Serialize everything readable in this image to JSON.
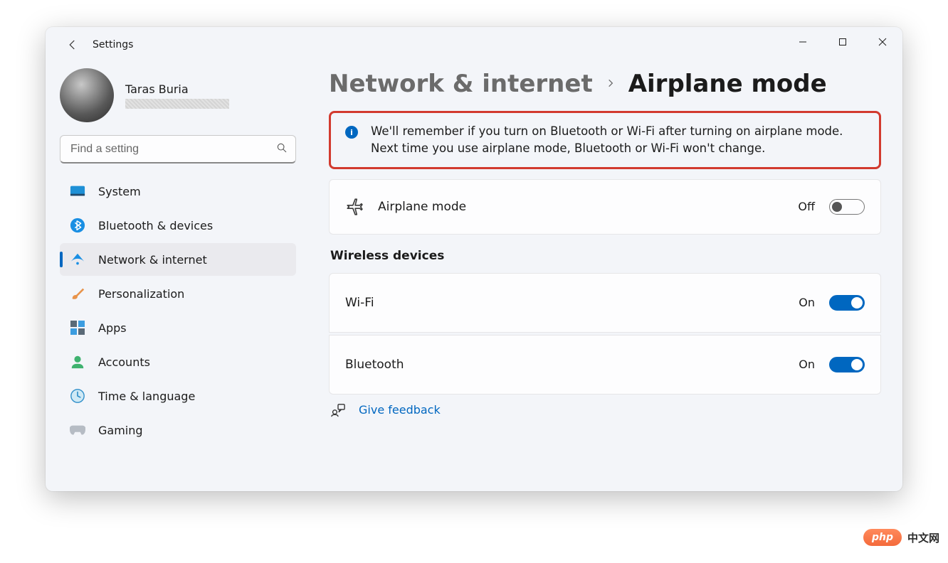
{
  "app_title": "Settings",
  "window_controls": {
    "minimize": "minimize",
    "maximize": "maximize",
    "close": "close"
  },
  "profile": {
    "name": "Taras Buria"
  },
  "search": {
    "placeholder": "Find a setting"
  },
  "sidebar": {
    "items": [
      {
        "id": "system",
        "label": "System",
        "icon": "system-icon",
        "active": false
      },
      {
        "id": "bluetooth",
        "label": "Bluetooth & devices",
        "icon": "bluetooth-icon",
        "active": false
      },
      {
        "id": "network",
        "label": "Network & internet",
        "icon": "wifi-icon",
        "active": true
      },
      {
        "id": "personalization",
        "label": "Personalization",
        "icon": "brush-icon",
        "active": false
      },
      {
        "id": "apps",
        "label": "Apps",
        "icon": "apps-icon",
        "active": false
      },
      {
        "id": "accounts",
        "label": "Accounts",
        "icon": "person-icon",
        "active": false
      },
      {
        "id": "time",
        "label": "Time & language",
        "icon": "clock-icon",
        "active": false
      },
      {
        "id": "gaming",
        "label": "Gaming",
        "icon": "gamepad-icon",
        "active": false
      }
    ]
  },
  "breadcrumb": {
    "parent": "Network & internet",
    "current": "Airplane mode"
  },
  "info_message": "We'll remember if you turn on Bluetooth or Wi-Fi after turning on airplane mode. Next time you use airplane mode, Bluetooth or Wi-Fi won't change.",
  "airplane_card": {
    "label": "Airplane mode",
    "state_label": "Off",
    "state_on": false
  },
  "wireless_header": "Wireless devices",
  "wireless": [
    {
      "id": "wifi",
      "label": "Wi-Fi",
      "state_label": "On",
      "state_on": true
    },
    {
      "id": "bt",
      "label": "Bluetooth",
      "state_label": "On",
      "state_on": true
    }
  ],
  "feedback_label": "Give feedback",
  "watermark": {
    "pill": "php",
    "text": "中文网"
  }
}
